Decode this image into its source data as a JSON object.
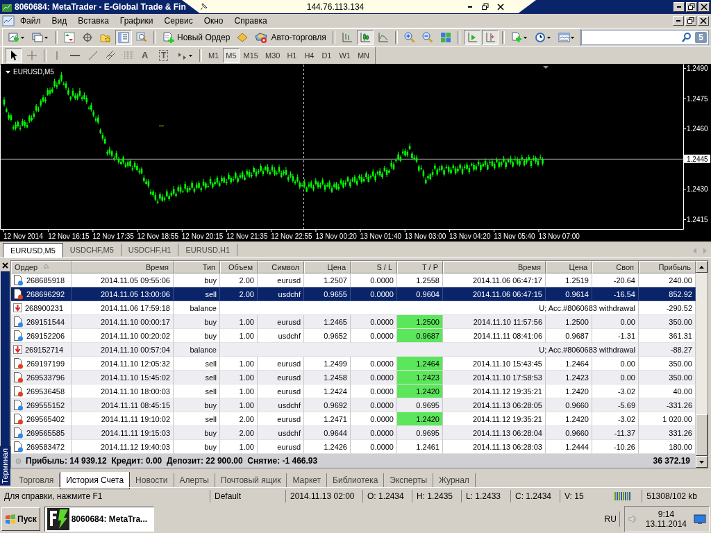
{
  "title_bar": {
    "title": "8060684: MetaTrader - E-Global Trade & Fin"
  },
  "remote_bar": {
    "host": "144.76.113.134"
  },
  "menu": [
    "Файл",
    "Вид",
    "Вставка",
    "Графики",
    "Сервис",
    "Окно",
    "Справка"
  ],
  "toolbar": [
    {
      "kind": "new-chart",
      "pressed": false
    },
    {
      "kind": "profiles",
      "pressed": false
    },
    {
      "kind": "sep"
    },
    {
      "kind": "market-watch",
      "pressed": false
    },
    {
      "kind": "navigator",
      "pressed": false
    },
    {
      "kind": "favorites",
      "pressed": false
    },
    {
      "kind": "terminal",
      "pressed": true
    },
    {
      "kind": "tester",
      "pressed": false
    },
    {
      "kind": "sep"
    },
    {
      "kind": "new-order",
      "pressed": false,
      "label": "Новый Ордер"
    },
    {
      "kind": "editor",
      "pressed": false
    },
    {
      "kind": "autotrading",
      "pressed": false,
      "label": "Авто-торговля"
    },
    {
      "kind": "sep"
    },
    {
      "kind": "bar-chart",
      "pressed": false
    },
    {
      "kind": "candle-chart",
      "pressed": true
    },
    {
      "kind": "line-chart",
      "pressed": false
    },
    {
      "kind": "sep"
    },
    {
      "kind": "zoom-in",
      "pressed": false
    },
    {
      "kind": "zoom-out",
      "pressed": false
    },
    {
      "kind": "tile",
      "pressed": false
    },
    {
      "kind": "sep"
    },
    {
      "kind": "autoscroll",
      "pressed": true
    },
    {
      "kind": "chart-shift",
      "pressed": true
    },
    {
      "kind": "sep"
    },
    {
      "kind": "indicators",
      "pressed": false
    },
    {
      "kind": "periods",
      "pressed": false
    },
    {
      "kind": "templates",
      "pressed": false
    }
  ],
  "search": {
    "badge": "5"
  },
  "drawing_toolbar": [
    {
      "kind": "cursor",
      "pressed": true
    },
    {
      "kind": "crosshair",
      "pressed": false
    },
    {
      "kind": "sep"
    },
    {
      "kind": "vline",
      "pressed": false
    },
    {
      "kind": "hline",
      "pressed": false
    },
    {
      "kind": "trendline",
      "pressed": false
    },
    {
      "kind": "channel",
      "pressed": false
    },
    {
      "kind": "fibo",
      "pressed": false
    },
    {
      "kind": "text",
      "pressed": false,
      "label": "A"
    },
    {
      "kind": "label",
      "pressed": false,
      "label": "T"
    },
    {
      "kind": "arrows",
      "pressed": false
    },
    {
      "kind": "sep"
    }
  ],
  "timeframes": [
    {
      "label": "M1",
      "selected": false
    },
    {
      "label": "M5",
      "selected": true
    },
    {
      "label": "M15",
      "selected": false
    },
    {
      "label": "M30",
      "selected": false
    },
    {
      "label": "H1",
      "selected": false
    },
    {
      "label": "H4",
      "selected": false
    },
    {
      "label": "D1",
      "selected": false
    },
    {
      "label": "W1",
      "selected": false
    },
    {
      "label": "MN",
      "selected": false
    }
  ],
  "chart": {
    "symbol": "EURUSD,M5",
    "price_labels": [
      {
        "text": "1.2490",
        "current": false
      },
      {
        "text": "1.2475",
        "current": false
      },
      {
        "text": "1.2460",
        "current": false
      },
      {
        "text": "1.2445",
        "current": true
      },
      {
        "text": "1.2430",
        "current": false
      },
      {
        "text": "1.2415",
        "current": false
      }
    ],
    "time_labels": [
      "12 Nov 2014",
      "12 Nov 16:15",
      "12 Nov 17:35",
      "12 Nov 18:55",
      "12 Nov 20:15",
      "12 Nov 21:35",
      "12 Nov 22:55",
      "13 Nov 00:20",
      "13 Nov 01:40",
      "13 Nov 03:00",
      "13 Nov 04:20",
      "13 Nov 05:40",
      "13 Nov 07:00"
    ]
  },
  "chart_tabs": [
    {
      "label": "EURUSD,M5",
      "selected": true
    },
    {
      "label": "USDCHF,M5",
      "selected": false
    },
    {
      "label": "USDCHF,H1",
      "selected": false
    },
    {
      "label": "EURUSD,H1",
      "selected": false
    }
  ],
  "history": {
    "columns": [
      {
        "label": "Ордер",
        "sorted": true
      },
      {
        "label": "Время",
        "sorted": false
      },
      {
        "label": "Тип",
        "sorted": false
      },
      {
        "label": "Объем",
        "sorted": false
      },
      {
        "label": "Символ",
        "sorted": false
      },
      {
        "label": "Цена",
        "sorted": false
      },
      {
        "label": "S / L",
        "sorted": false
      },
      {
        "label": "T / P",
        "sorted": false
      },
      {
        "label": "Время",
        "sorted": false
      },
      {
        "label": "Цена",
        "sorted": false
      },
      {
        "label": "Своп",
        "sorted": false
      },
      {
        "label": "Прибыль",
        "sorted": false
      }
    ],
    "rows": [
      {
        "kind": "buy",
        "selected": false,
        "tp_hit": false,
        "cells": [
          "268685918",
          "2014.11.05 09:55:06",
          "buy",
          "2.00",
          "eurusd",
          "1.2507",
          "0.0000",
          "1.2558",
          "2014.11.06 06:47:17",
          "1.2519",
          "-20.64",
          "240.00"
        ]
      },
      {
        "kind": "sell",
        "selected": true,
        "tp_hit": false,
        "cells": [
          "268696292",
          "2014.11.05 13:00:06",
          "sell",
          "2.00",
          "usdchf",
          "0.9655",
          "0.0000",
          "0.9604",
          "2014.11.06 06:47:15",
          "0.9614",
          "-16.54",
          "852.92"
        ]
      },
      {
        "kind": "balance",
        "selected": false,
        "cells": [
          "268900231",
          "2014.11.06 17:59:18",
          "balance",
          "U; Acc.#8060683 withdrawal",
          "-290.52"
        ]
      },
      {
        "kind": "buy",
        "selected": false,
        "tp_hit": true,
        "cells": [
          "269151544",
          "2014.11.10 00:00:17",
          "buy",
          "1.00",
          "eurusd",
          "1.2465",
          "0.0000",
          "1.2500",
          "2014.11.10 11:57:56",
          "1.2500",
          "0.00",
          "350.00"
        ]
      },
      {
        "kind": "buy",
        "selected": false,
        "tp_hit": true,
        "cells": [
          "269152206",
          "2014.11.10 00:20:02",
          "buy",
          "1.00",
          "usdchf",
          "0.9652",
          "0.0000",
          "0.9687",
          "2014.11.11 08:41:06",
          "0.9687",
          "-1.31",
          "361.31"
        ]
      },
      {
        "kind": "balance",
        "selected": false,
        "cells": [
          "269152714",
          "2014.11.10 00:57:04",
          "balance",
          "U; Acc.#8060683 withdrawal",
          "-88.27"
        ]
      },
      {
        "kind": "sell",
        "selected": false,
        "tp_hit": true,
        "cells": [
          "269197199",
          "2014.11.10 12:05:32",
          "sell",
          "1.00",
          "eurusd",
          "1.2499",
          "0.0000",
          "1.2464",
          "2014.11.10 15:43:45",
          "1.2464",
          "0.00",
          "350.00"
        ]
      },
      {
        "kind": "sell",
        "selected": false,
        "tp_hit": true,
        "cells": [
          "269533796",
          "2014.11.10 15:45:02",
          "sell",
          "1.00",
          "eurusd",
          "1.2458",
          "0.0000",
          "1.2423",
          "2014.11.10 17:58:53",
          "1.2423",
          "0.00",
          "350.00"
        ]
      },
      {
        "kind": "sell",
        "selected": false,
        "tp_hit": true,
        "cells": [
          "269536458",
          "2014.11.10 18:00:03",
          "sell",
          "1.00",
          "eurusd",
          "1.2424",
          "0.0000",
          "1.2420",
          "2014.11.12 19:35:21",
          "1.2420",
          "-3.02",
          "40.00"
        ]
      },
      {
        "kind": "buy",
        "selected": false,
        "tp_hit": false,
        "cells": [
          "269555152",
          "2014.11.11 08:45:15",
          "buy",
          "1.00",
          "usdchf",
          "0.9692",
          "0.0000",
          "0.9695",
          "2014.11.13 06:28:05",
          "0.9660",
          "-5.69",
          "-331.26"
        ]
      },
      {
        "kind": "sell",
        "selected": false,
        "tp_hit": true,
        "cells": [
          "269565402",
          "2014.11.11 19:10:02",
          "sell",
          "2.00",
          "eurusd",
          "1.2471",
          "0.0000",
          "1.2420",
          "2014.11.12 19:35:21",
          "1.2420",
          "-3.02",
          "1 020.00"
        ]
      },
      {
        "kind": "buy",
        "selected": false,
        "tp_hit": false,
        "cells": [
          "269565585",
          "2014.11.11 19:15:03",
          "buy",
          "2.00",
          "usdchf",
          "0.9644",
          "0.0000",
          "0.9695",
          "2014.11.13 06:28:04",
          "0.9660",
          "-11.37",
          "331.26"
        ]
      },
      {
        "kind": "buy",
        "selected": false,
        "tp_hit": false,
        "cells": [
          "269583472",
          "2014.11.12 19:40:03",
          "buy",
          "1.00",
          "eurusd",
          "1.2426",
          "0.0000",
          "1.2461",
          "2014.11.13 06:28:03",
          "1.2444",
          "-10.26",
          "180.00"
        ]
      }
    ],
    "summary": "Прибыль: 14 939.12  Кредит: 0.00  Депозит: 22 900.00  Снятие: -1 466.93",
    "total": "36 372.19"
  },
  "terminal_label": "Терминал",
  "terminal_tabs": [
    {
      "label": "Торговля",
      "selected": false
    },
    {
      "label": "История Счета",
      "selected": true
    },
    {
      "label": "Новости",
      "selected": false
    },
    {
      "label": "Алерты",
      "selected": false
    },
    {
      "label": "Почтовый ящик",
      "selected": false
    },
    {
      "label": "Маркет",
      "selected": false
    },
    {
      "label": "Библиотека",
      "selected": false
    },
    {
      "label": "Эксперты",
      "selected": false
    },
    {
      "label": "Журнал",
      "selected": false
    }
  ],
  "status_bar": {
    "help": "Для справки, нажмите F1",
    "profile": "Default",
    "fields": [
      "2014.11.13 02:00",
      "O: 1.2434",
      "H: 1.2435",
      "L: 1.2433",
      "C: 1.2434",
      "V: 15"
    ],
    "traffic": "51308/102 kb"
  },
  "taskbar": {
    "start": "Пуск",
    "task": "8060684: MetaTra...",
    "language": "RU",
    "time": "9:14",
    "date": "13.11.2014"
  }
}
